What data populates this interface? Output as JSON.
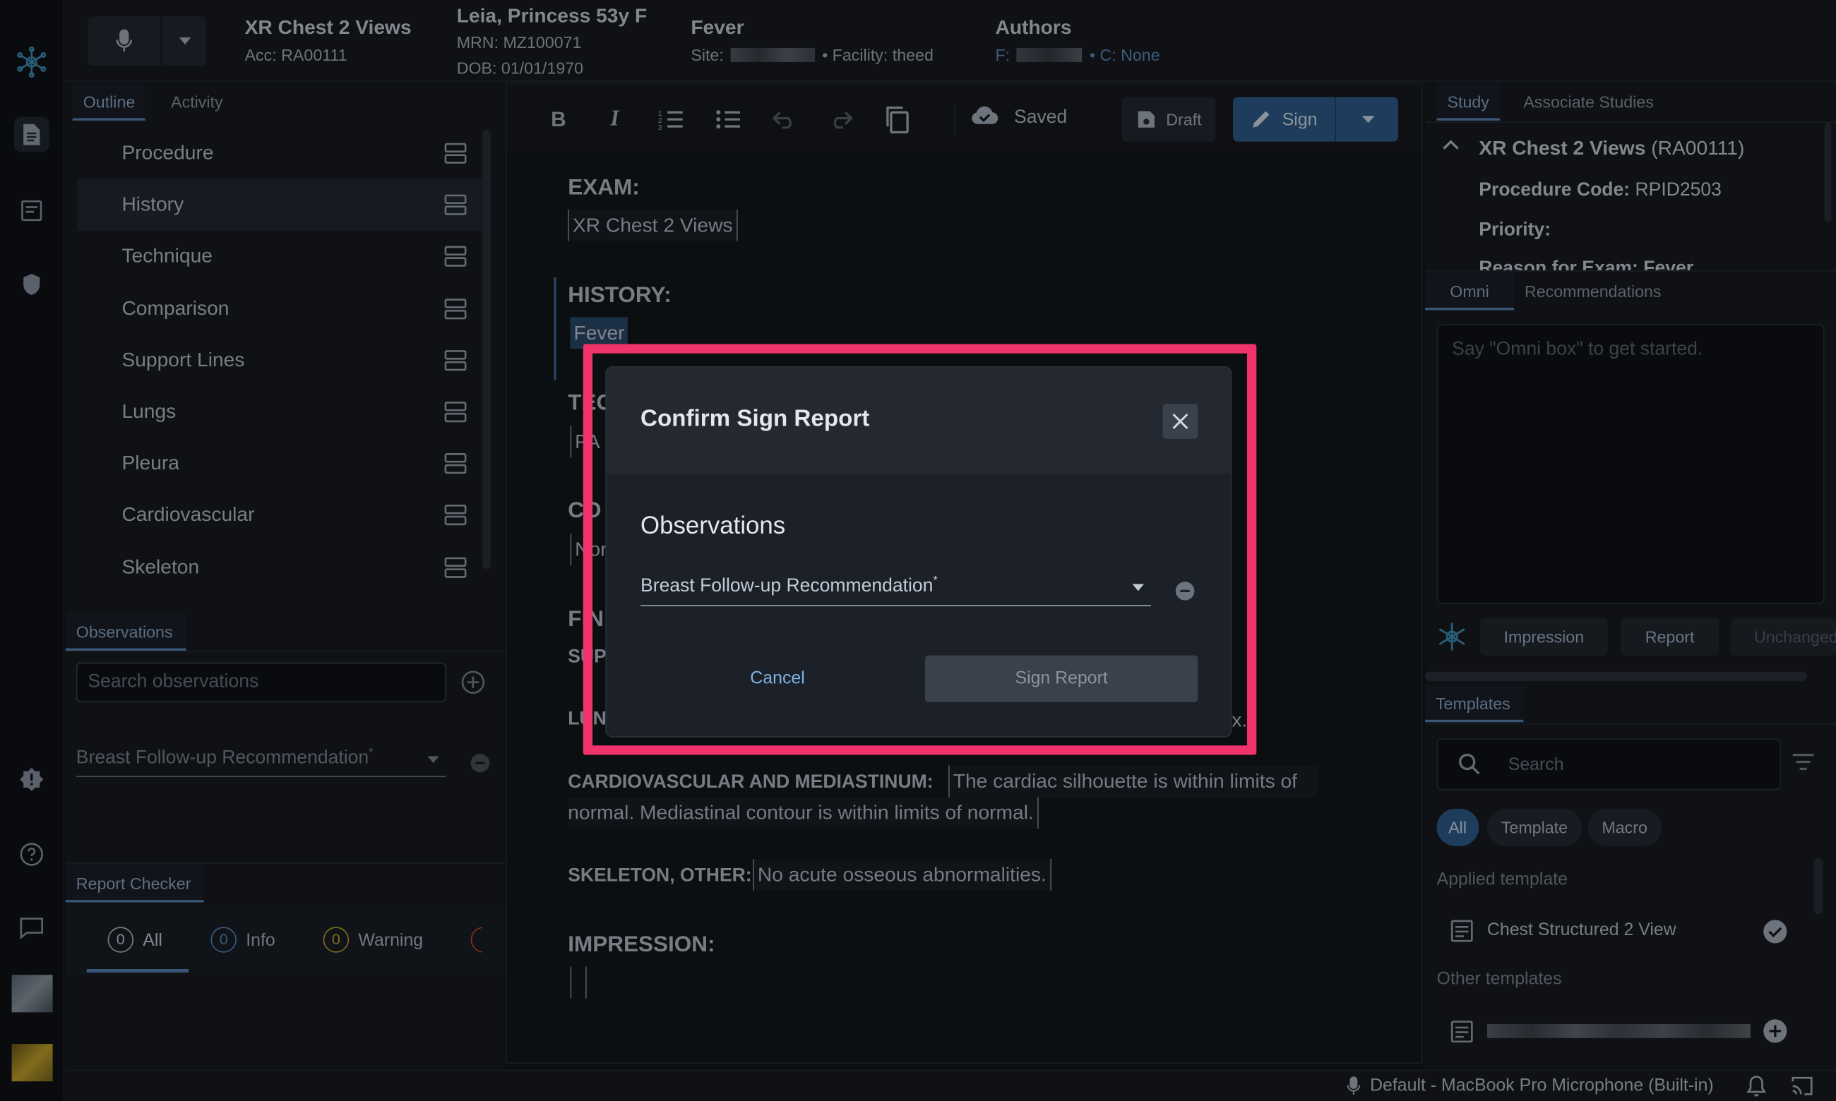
{
  "app": {
    "rail_icons": [
      "app-logo-icon",
      "document-icon",
      "worklist-icon",
      "shield-icon",
      "alert-icon",
      "help-icon",
      "chat-icon",
      "avatar-1",
      "avatar-2"
    ]
  },
  "header": {
    "exam_title": "XR Chest 2 Views",
    "accession": "Acc: RA00111",
    "patient_name": "Leia, Princess 53y F",
    "mrn": "MRN: MZ100071",
    "dob": "DOB: 01/01/1970",
    "reason": "Fever",
    "site_label": "Site:",
    "facility": "• Facility: theed",
    "authors_label": "Authors",
    "authors_f": "F:",
    "authors_c": "• C: None"
  },
  "left_panel": {
    "tabs": [
      "Outline",
      "Activity"
    ],
    "outline_items": [
      "Procedure",
      "History",
      "Technique",
      "Comparison",
      "Support Lines",
      "Lungs",
      "Pleura",
      "Cardiovascular",
      "Skeleton"
    ],
    "active_item": "History",
    "observations_tab": "Observations",
    "search_placeholder": "Search observations",
    "observation_field": "Breast Follow-up Recommendation",
    "required_mark": "*",
    "report_checker_tab": "Report Checker",
    "checker": [
      {
        "count": "0",
        "label": "All"
      },
      {
        "count": "0",
        "label": "Info"
      },
      {
        "count": "0",
        "label": "Warning"
      }
    ]
  },
  "toolbar": {
    "saved_label": "Saved",
    "draft_label": "Draft",
    "sign_label": "Sign"
  },
  "editor": {
    "exam_hdr": "EXAM:",
    "exam_val": "XR Chest 2 Views",
    "history_hdr": "HISTORY:",
    "history_val": "Fever",
    "tech_hdr_partial": "TEC",
    "tech_val_partial": "PA",
    "comp_hdr_partial": "CO",
    "comp_val_partial": "Nor",
    "findings_partial": "FIN",
    "support_partial": "SUP",
    "lungs_partial": "LUN",
    "lungs_end_partial": "x.",
    "cardio_hdr": "CARDIOVASCULAR AND MEDIASTINUM:",
    "cardio_val_1": "The cardiac silhouette is within limits of",
    "cardio_val_2": "normal. Mediastinal contour is within limits of normal.",
    "skeleton_hdr": "SKELETON, OTHER:",
    "skeleton_val": "No acute osseous abnormalities.",
    "impression_hdr": "IMPRESSION:"
  },
  "right_panel": {
    "tabs": [
      "Study",
      "Associate Studies"
    ],
    "study_title": "XR Chest 2 Views",
    "study_acc": "(RA00111)",
    "procedure_code_label": "Procedure Code:",
    "procedure_code": "RPID2503",
    "priority_label": "Priority:",
    "reason_partial": "Reason for Exam: Fever",
    "omni_tabs": [
      "Omni",
      "Recommendations"
    ],
    "omni_placeholder": "Say \"Omni box\" to get started.",
    "omni_buttons": [
      "Impression",
      "Report",
      "Unchanged"
    ],
    "templates_tab": "Templates",
    "search_placeholder": "Search",
    "filter_pills": [
      "All",
      "Template",
      "Macro"
    ],
    "applied_label": "Applied template",
    "applied_template": "Chest Structured 2 View",
    "other_label": "Other templates"
  },
  "status_bar": {
    "microphone": "Default - MacBook Pro Microphone (Built-in)"
  },
  "modal": {
    "title": "Confirm Sign Report",
    "section": "Observations",
    "field_label": "Breast Follow-up Recommendation",
    "required_mark": "*",
    "cancel_label": "Cancel",
    "sign_label": "Sign Report"
  },
  "colors": {
    "accent": "#5c88b8",
    "highlight": "#f0336b",
    "sign_button": "#2f5d8d"
  }
}
